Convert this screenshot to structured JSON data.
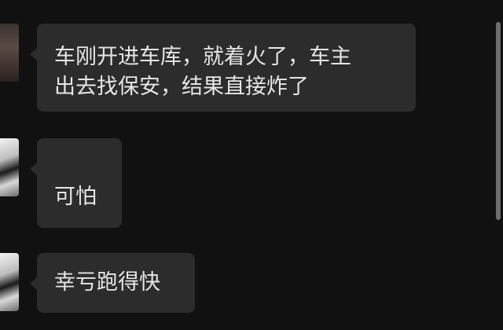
{
  "messages": [
    {
      "text": "车刚开进车库，就着火了，车主\n出去找保安，结果直接炸了"
    },
    {
      "text": "可怕"
    },
    {
      "text": "幸亏跑得快"
    }
  ],
  "colors": {
    "background": "#111111",
    "bubble": "#2c2c2c",
    "text": "#e6e6e6",
    "scrollbar": "#6e6e6e"
  }
}
